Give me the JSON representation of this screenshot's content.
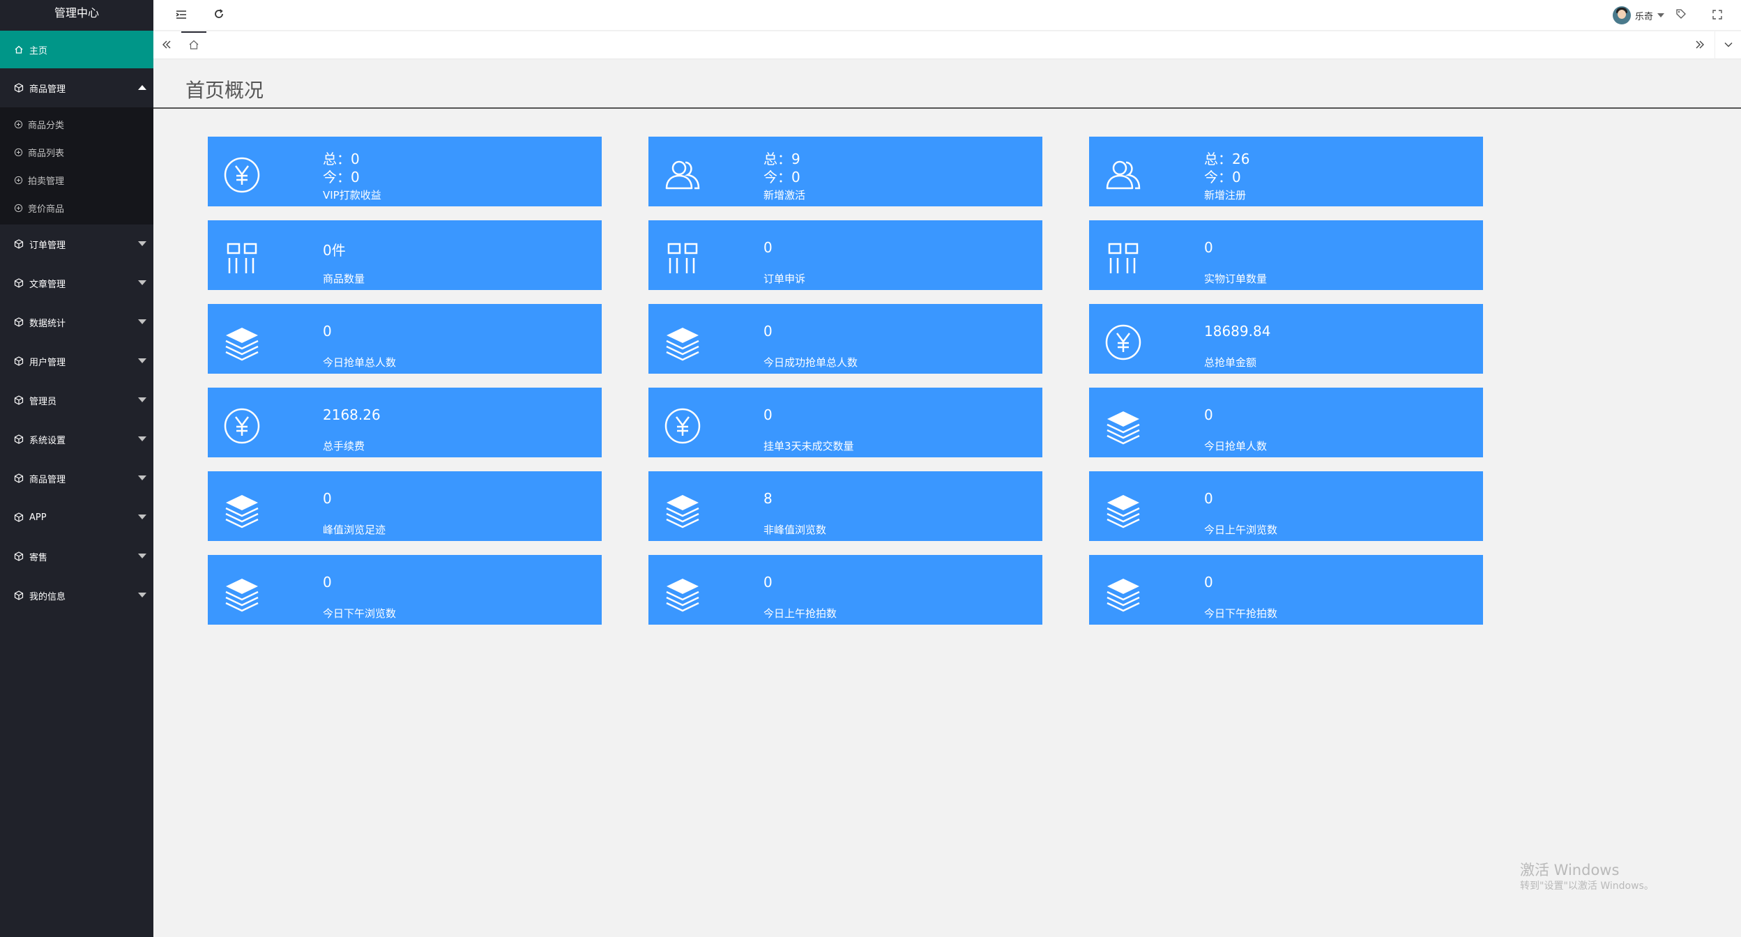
{
  "app": {
    "title": "管理中心"
  },
  "colors": {
    "sidebar": "#20222a",
    "active": "#009688",
    "card": "#3a97ff"
  },
  "sidebar": {
    "home": {
      "label": "主页",
      "icon": "home-icon"
    },
    "items": [
      {
        "label": "商品管理",
        "icon": "cube-icon",
        "expanded": true,
        "children": [
          {
            "label": "商品分类",
            "icon": "plus-circle-icon"
          },
          {
            "label": "商品列表",
            "icon": "plus-circle-icon"
          },
          {
            "label": "拍卖管理",
            "icon": "plus-circle-icon"
          },
          {
            "label": "竞价商品",
            "icon": "plus-circle-icon"
          }
        ]
      },
      {
        "label": "订单管理",
        "icon": "cube-icon"
      },
      {
        "label": "文章管理",
        "icon": "cube-icon"
      },
      {
        "label": "数据统计",
        "icon": "cube-icon"
      },
      {
        "label": "用户管理",
        "icon": "cube-icon"
      },
      {
        "label": "管理员",
        "icon": "cube-icon"
      },
      {
        "label": "系统设置",
        "icon": "cube-icon"
      },
      {
        "label": "商品管理",
        "icon": "cube-icon"
      },
      {
        "label": "APP",
        "icon": "cube-icon"
      },
      {
        "label": "寄售",
        "icon": "cube-icon"
      },
      {
        "label": "我的信息",
        "icon": "cube-icon"
      }
    ]
  },
  "header": {
    "user_name": "乐奇"
  },
  "main": {
    "title": "首页概况"
  },
  "cards": [
    {
      "icon": "yen-icon",
      "line1": "总：0",
      "line2": "今：0",
      "label": "VIP打款收益"
    },
    {
      "icon": "users-icon",
      "line1": "总：9",
      "line2": "今：0",
      "label": "新增激活"
    },
    {
      "icon": "users-icon",
      "line1": "总：26",
      "line2": "今：0",
      "label": "新增注册"
    },
    {
      "icon": "grid-icon",
      "value": "0件",
      "label": "商品数量"
    },
    {
      "icon": "grid-icon",
      "value": "0",
      "label": "订单申诉"
    },
    {
      "icon": "grid-icon",
      "value": "0",
      "label": "实物订单数量"
    },
    {
      "icon": "layers-icon",
      "value": "0",
      "label": "今日抢单总人数"
    },
    {
      "icon": "layers-icon",
      "value": "0",
      "label": "今日成功抢单总人数"
    },
    {
      "icon": "yen-icon",
      "value": "18689.84",
      "label": "总抢单金额"
    },
    {
      "icon": "yen-icon",
      "value": "2168.26",
      "label": "总手续费"
    },
    {
      "icon": "yen-icon",
      "value": "0",
      "label": "挂单3天未成交数量"
    },
    {
      "icon": "layers-icon",
      "value": "0",
      "label": "今日抢单人数"
    },
    {
      "icon": "layers-icon",
      "value": "0",
      "label": "峰值浏览足迹"
    },
    {
      "icon": "layers-icon",
      "value": "8",
      "label": "非峰值浏览数"
    },
    {
      "icon": "layers-icon",
      "value": "0",
      "label": "今日上午浏览数"
    },
    {
      "icon": "layers-icon",
      "value": "0",
      "label": "今日下午浏览数"
    },
    {
      "icon": "layers-icon",
      "value": "0",
      "label": "今日上午抢拍数"
    },
    {
      "icon": "layers-icon",
      "value": "0",
      "label": "今日下午抢拍数"
    }
  ],
  "watermark": {
    "line1": "激活 Windows",
    "line2": "转到\"设置\"以激活 Windows。"
  }
}
